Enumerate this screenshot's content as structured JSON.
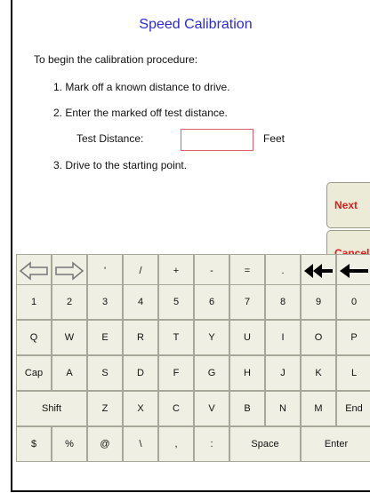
{
  "title": "Speed Calibration",
  "instructions": {
    "intro": "To begin the calibration procedure:",
    "step1": "1. Mark off a known distance to drive.",
    "step2": "2. Enter the marked off test distance.",
    "distance_label": "Test Distance:",
    "distance_value": "",
    "distance_unit": "Feet",
    "step3": "3. Drive to the starting point."
  },
  "buttons": {
    "next": "Next",
    "cancel": "Cancel"
  },
  "keyboard": {
    "row0": [
      {
        "name": "key-cursor-left",
        "icon": "outline-left-arrow-icon"
      },
      {
        "name": "key-cursor-right",
        "icon": "outline-right-arrow-icon"
      },
      {
        "label": "'"
      },
      {
        "label": "/"
      },
      {
        "label": "+"
      },
      {
        "label": "-"
      },
      {
        "label": "="
      },
      {
        "label": "."
      },
      {
        "name": "key-clear",
        "icon": "double-left-arrow-icon"
      },
      {
        "name": "key-backspace",
        "icon": "left-arrow-icon"
      }
    ],
    "row1": [
      "1",
      "2",
      "3",
      "4",
      "5",
      "6",
      "7",
      "8",
      "9",
      "0"
    ],
    "row2": [
      "Q",
      "W",
      "E",
      "R",
      "T",
      "Y",
      "U",
      "I",
      "O",
      "P"
    ],
    "row3": [
      "Cap",
      "A",
      "S",
      "D",
      "F",
      "G",
      "H",
      "J",
      "K",
      "L"
    ],
    "row4": [
      "Shift",
      "Z",
      "X",
      "C",
      "V",
      "B",
      "N",
      "M",
      "End"
    ],
    "row5": [
      "$",
      "%",
      "@",
      "\\",
      ",",
      ":",
      "Space",
      "Enter"
    ]
  }
}
